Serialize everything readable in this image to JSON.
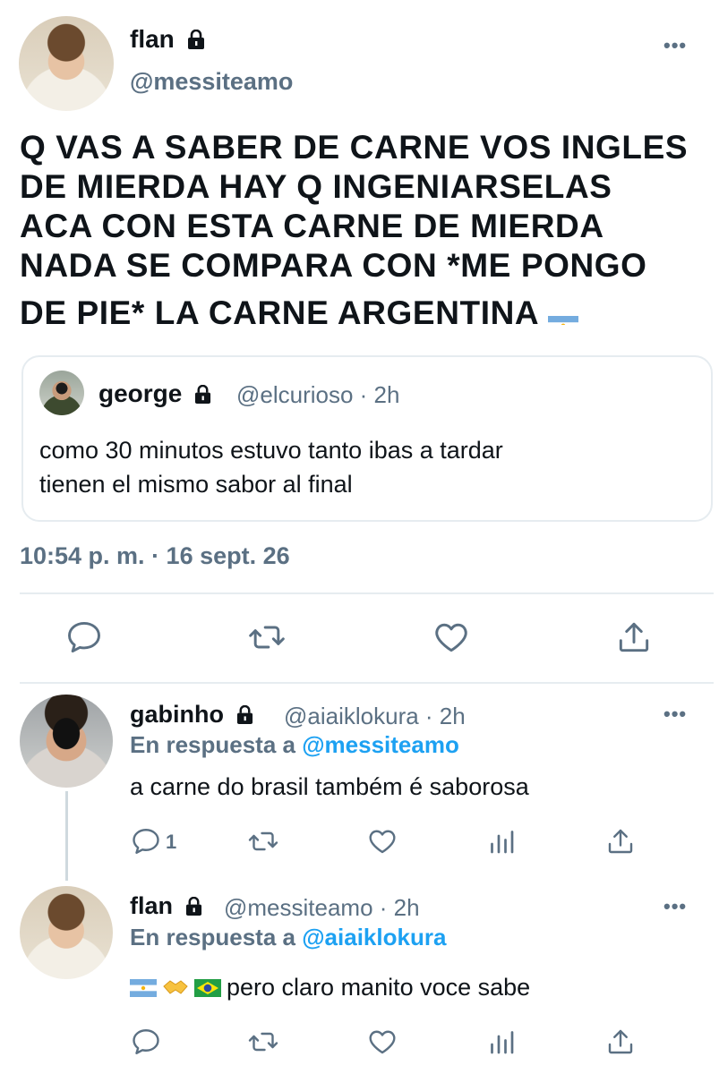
{
  "tweet": {
    "author_name": "flan",
    "author_handle": "@messiteamo",
    "more_label": "•••",
    "text_lines": [
      "Q VAS A SABER DE CARNE VOS INGLES",
      "DE MIERDA HAY Q INGENIARSELAS",
      "ACA CON ESTA CARNE DE MIERDA",
      "NADA SE COMPARA CON *ME PONGO",
      "DE PIE* LA CARNE ARGENTINA"
    ],
    "timestamp": "10:54 p. m. · 16 sept. 26"
  },
  "quote": {
    "author_name": "george",
    "meta": "@elcurioso · 2h",
    "text_lines": [
      "como 30 minutos estuvo tanto ibas a tardar",
      "tienen el mismo sabor al final"
    ]
  },
  "replies": [
    {
      "author_name": "gabinho",
      "meta": "@aiaiklokura · 2h",
      "reply_prefix": "En respuesta a ",
      "reply_mention": "@messiteamo",
      "text": "a carne do brasil também é saborosa",
      "reply_count": "1"
    },
    {
      "author_name": "flan",
      "meta": "@messiteamo · 2h",
      "reply_prefix": "En respuesta a ",
      "reply_mention": "@aiaiklokura",
      "text": "pero claro manito voce sabe"
    }
  ],
  "icons": {
    "lock": "lock-icon",
    "reply": "reply-icon",
    "retweet": "retweet-icon",
    "like": "heart-icon",
    "share": "share-icon",
    "analytics": "analytics-icon"
  },
  "colors": {
    "text": "#0f1419",
    "secondary": "#5b7083",
    "link": "#1da1f2",
    "divider": "#e6ecf0"
  }
}
